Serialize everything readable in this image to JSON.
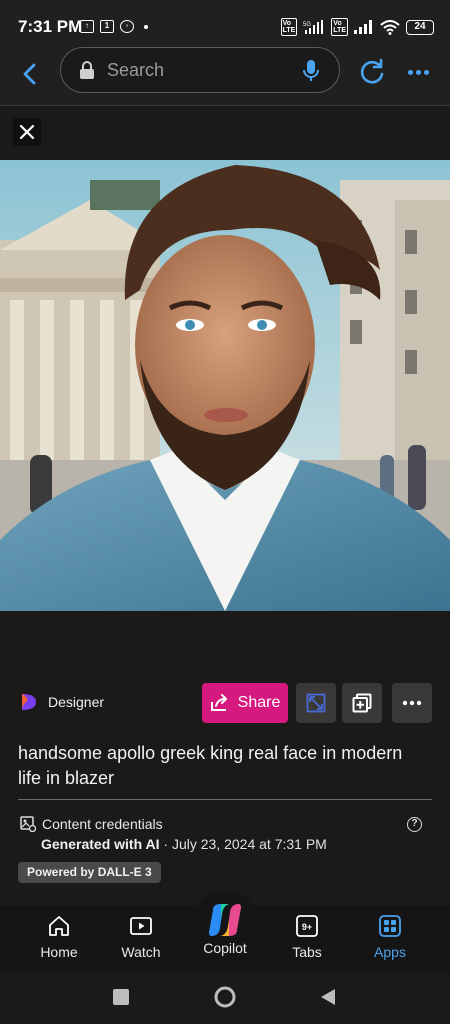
{
  "status_bar": {
    "time": "7:31 PM",
    "battery": "24",
    "network": "5G"
  },
  "toolbar": {
    "search_placeholder": "Search"
  },
  "designer": {
    "label": "Designer",
    "share_label": "Share"
  },
  "prompt_text": "handsome apollo greek king real face in modern life in blazer",
  "credentials": {
    "title": "Content credentials",
    "generated_prefix": "Generated with AI",
    "generated_date": " · July 23, 2024 at 7:31 PM",
    "badge": "Powered by DALL-E 3"
  },
  "bottom_nav": {
    "items": [
      {
        "label": "Home",
        "icon": "home-icon"
      },
      {
        "label": "Watch",
        "icon": "play-icon"
      },
      {
        "label": "Copilot",
        "icon": "copilot-icon"
      },
      {
        "label": "Tabs",
        "icon": "tabs-icon",
        "badge": "9+"
      },
      {
        "label": "Apps",
        "icon": "apps-icon",
        "active": true
      }
    ]
  },
  "colors": {
    "accent": "#4aa3f0",
    "share": "#d6197f"
  }
}
